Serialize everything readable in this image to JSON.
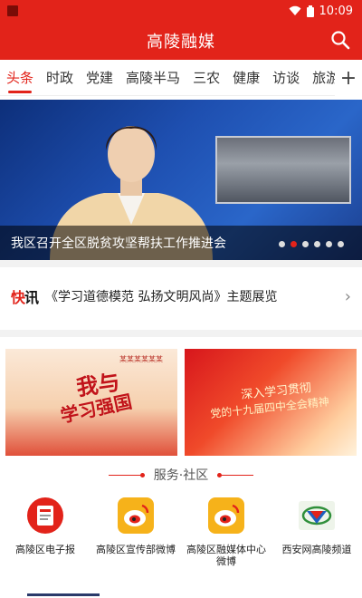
{
  "status_bar": {
    "time": "10:09"
  },
  "app_bar": {
    "title": "高陵融媒"
  },
  "tabs": [
    {
      "label": "头条",
      "active": true
    },
    {
      "label": "时政"
    },
    {
      "label": "党建"
    },
    {
      "label": "高陵半马"
    },
    {
      "label": "三农"
    },
    {
      "label": "健康"
    },
    {
      "label": "访谈"
    },
    {
      "label": "旅游"
    }
  ],
  "banner": {
    "caption": "我区召开全区脱贫攻坚帮扶工作推进会",
    "slide_count": 6,
    "active_slide": 2
  },
  "flash": {
    "logo_a": "快",
    "logo_b": "讯",
    "text": "《学习道德模范  弘扬文明风尚》主题展览"
  },
  "posters": [
    {
      "top_text": "某某某某某某",
      "line1": "我与",
      "line2": "学习强国"
    },
    {
      "line1": "深入学习贯彻",
      "line2": "党的十九届四中全会精神"
    }
  ],
  "services_section": {
    "title": "服务·社区",
    "items": [
      {
        "label": "高陵区电子报",
        "icon": "newspaper-icon"
      },
      {
        "label": "高陵区宣传部微博",
        "icon": "weibo-icon"
      },
      {
        "label": "高陵区融媒体中心微博",
        "icon": "weibo-icon"
      },
      {
        "label": "西安网高陵频道",
        "icon": "xian-net-icon"
      }
    ]
  },
  "colors": {
    "brand_red": "#e2231a"
  }
}
